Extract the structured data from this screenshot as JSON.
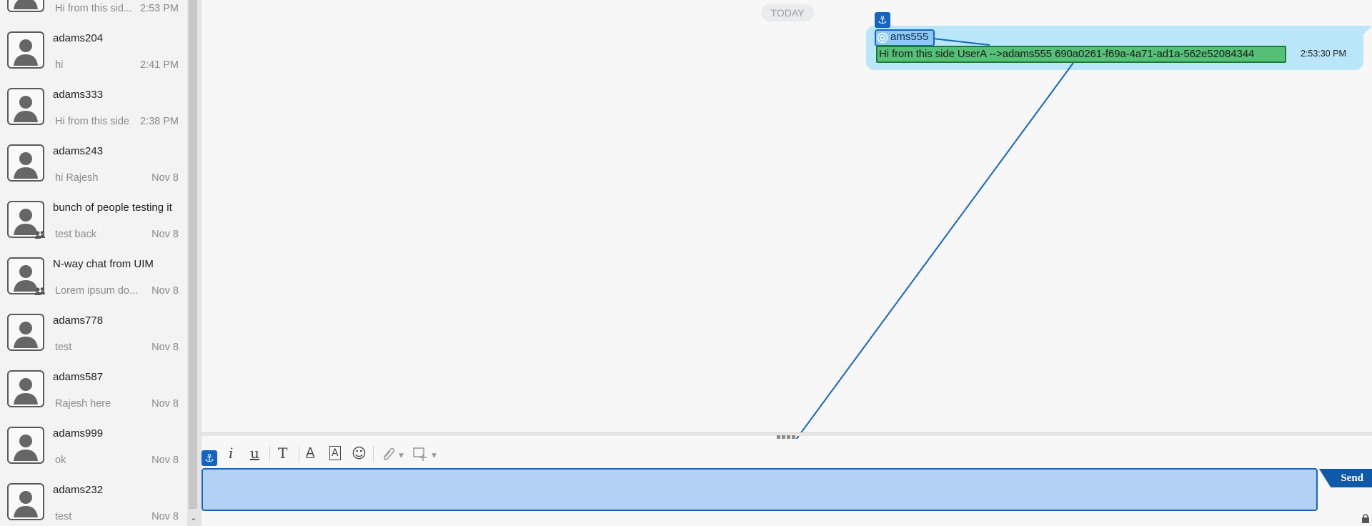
{
  "conversations": [
    {
      "name": "",
      "preview": "Hi from this sid...",
      "time": "2:53 PM",
      "group": false
    },
    {
      "name": "adams204",
      "preview": "hi",
      "time": "2:41 PM",
      "group": false
    },
    {
      "name": "adams333",
      "preview": "Hi from this side",
      "time": "2:38 PM",
      "group": false
    },
    {
      "name": "adams243",
      "preview": "hi Rajesh",
      "time": "Nov 8",
      "group": false
    },
    {
      "name": "bunch of people testing it",
      "preview": "test back",
      "time": "Nov 8",
      "group": true
    },
    {
      "name": "N-way chat from UIM",
      "preview": "Lorem ipsum do...",
      "time": "Nov 8",
      "group": true
    },
    {
      "name": "adams778",
      "preview": "test",
      "time": "Nov 8",
      "group": false
    },
    {
      "name": "adams587",
      "preview": "Rajesh here",
      "time": "Nov 8",
      "group": false
    },
    {
      "name": "adams999",
      "preview": "ok",
      "time": "Nov 8",
      "group": false
    },
    {
      "name": "adams232",
      "preview": "test",
      "time": "Nov 8",
      "group": false
    }
  ],
  "chat": {
    "date_divider": "TODAY",
    "message": {
      "sender": "ams555",
      "text": "Hi from this side UserA -->adams555 690a0261-f69a-4a71-ad1a-562e52084344",
      "time": "2:53:30 PM"
    }
  },
  "composer": {
    "toolbar": {
      "italic": "i",
      "underline": "u",
      "text_format": "T",
      "font_color": "A",
      "highlight": "A",
      "emoji": "☺"
    },
    "send_label": "Send"
  },
  "icons": {
    "anchor": "⚓",
    "scroll_down": "⌄"
  },
  "colors": {
    "accent": "#1565c0",
    "bubble": "#b9e6f8",
    "input_highlight": "#b3d1f5",
    "message_highlight": "#55c078"
  }
}
